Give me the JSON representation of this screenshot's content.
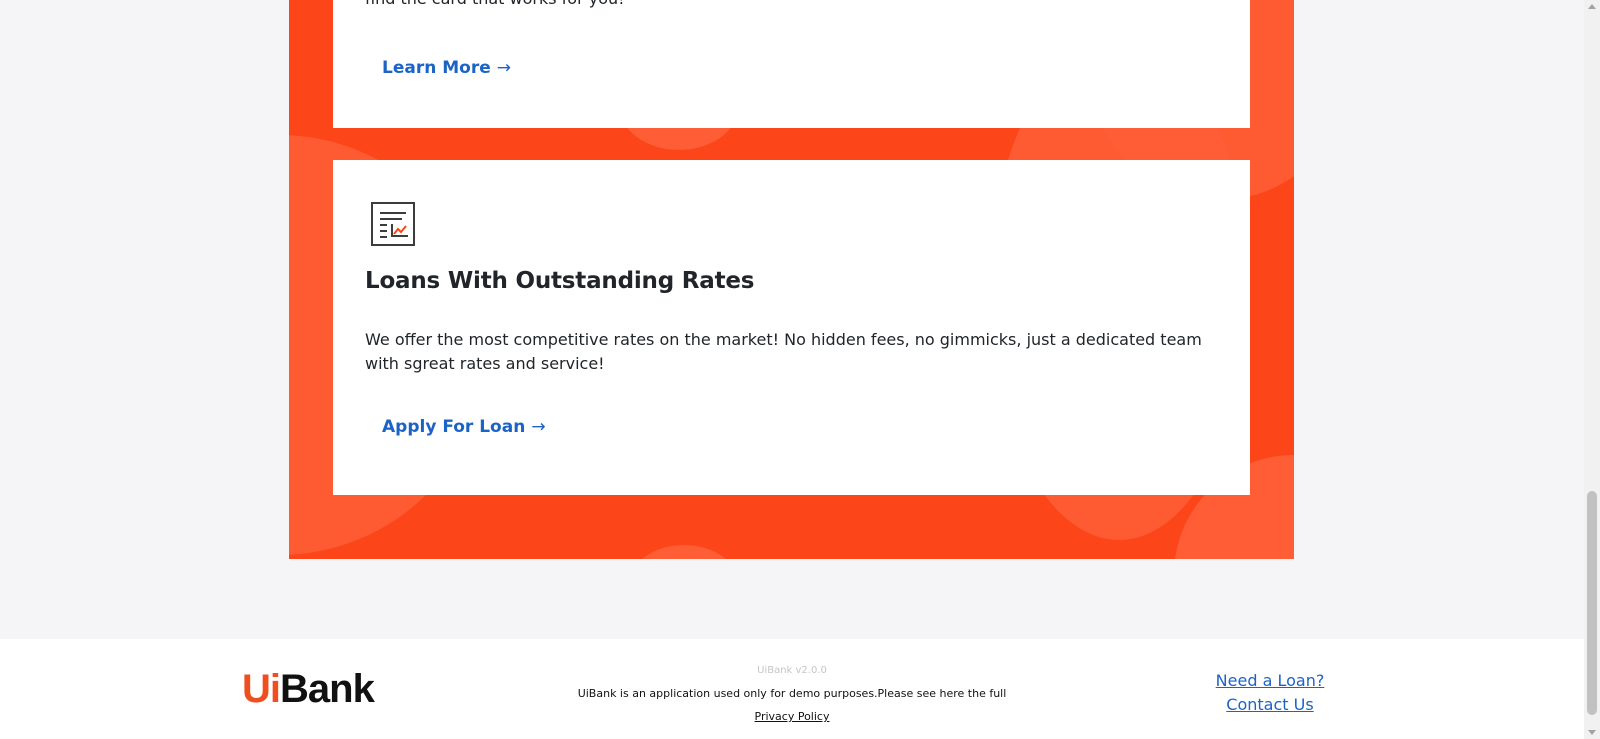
{
  "promo": {
    "card_top": {
      "text": "find the card that works for you!",
      "cta_label": "Learn More",
      "cta_arrow": "→"
    },
    "card_loan": {
      "icon": "chart-report-icon",
      "title": "Loans With Outstanding Rates",
      "body": "We offer the most competitive rates on the market! No hidden fees, no gimmicks, just a dedicated team with sgreat rates and service!",
      "cta_label": "Apply For Loan",
      "cta_arrow": "→"
    }
  },
  "footer": {
    "logo": {
      "ui": "Ui",
      "bank": "Bank"
    },
    "version": "UiBank v2.0.0",
    "disclaimer": "UiBank is an application used only for demo purposes.Please see here the full",
    "privacy_link": "Privacy Policy",
    "links": [
      "Need a Loan?",
      "Contact Us"
    ]
  },
  "colors": {
    "brand_orange": "#fc4619",
    "link_blue": "#1b63c6",
    "logo_orange": "#f04e1e"
  }
}
